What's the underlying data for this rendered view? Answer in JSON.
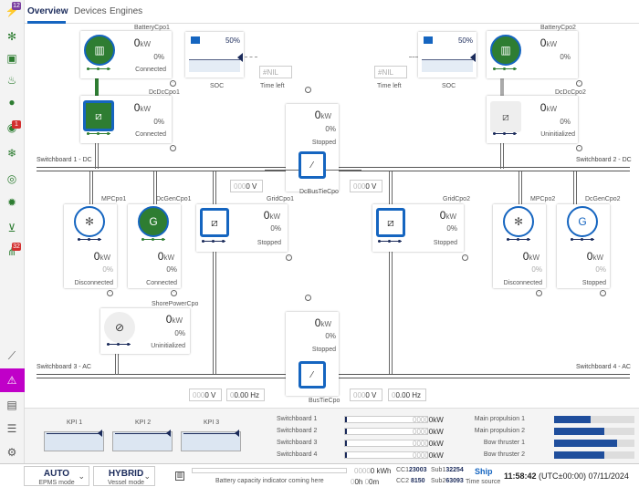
{
  "tabs": [
    {
      "label": "Overview",
      "active": true
    },
    {
      "label": "Devices",
      "active": false
    },
    {
      "label": "Engines",
      "active": false
    }
  ],
  "rail": {
    "icons": [
      "energy-icon",
      "fan-icon",
      "cabinet-icon",
      "flame-icon",
      "tank-icon",
      "sensor-icon",
      "snowflake-icon",
      "ring-icon",
      "bulb-icon",
      "valve-icon",
      "network-icon",
      "chart-icon",
      "alarm-icon",
      "document-icon",
      "list-icon",
      "gear-icon"
    ],
    "badges": {
      "top": "12",
      "mid": "1",
      "net": "32"
    }
  },
  "switchboards": {
    "sb1": "Switchboard 1 - DC",
    "sb2": "Switchboard 2 - DC",
    "sb3": "Switchboard 3 - AC",
    "sb4": "Switchboard 4 - AC"
  },
  "units": {
    "kw": "kW",
    "pct": "%",
    "v": "V",
    "hz": "Hz"
  },
  "cards": {
    "battery1": {
      "name": "BatteryCpo1",
      "kw": "0",
      "pct": "0",
      "status": "Connected"
    },
    "dcdc1": {
      "name": "DcDcCpo1",
      "kw": "0",
      "pct": "0",
      "status": "Connected"
    },
    "battery2": {
      "name": "BatteryCpo2",
      "kw": "0",
      "pct": "0",
      "status": ""
    },
    "dcdc2": {
      "name": "DcDcCpo2",
      "kw": "0",
      "pct": "0",
      "status": "Uninitialized"
    },
    "dcbustie": {
      "name": "DcBusTieCpo",
      "kw": "0",
      "pct": "0",
      "status": "Stopped"
    },
    "mp1": {
      "name": "MPCpo1",
      "kw": "0",
      "pct": "0",
      "status": "Disconnected"
    },
    "dcgen1": {
      "name": "DcGenCpo1",
      "kw": "0",
      "pct": "0",
      "status": "Connected"
    },
    "grid1": {
      "name": "GridCpo1",
      "kw": "0",
      "pct": "0",
      "status": "Stopped"
    },
    "grid2": {
      "name": "GridCpo2",
      "kw": "0",
      "pct": "0",
      "status": "Stopped"
    },
    "mp2": {
      "name": "MPCpo2",
      "kw": "0",
      "pct": "0",
      "status": "Disconnected"
    },
    "dcgen2": {
      "name": "DcGenCpo2",
      "kw": "0",
      "pct": "0",
      "status": "Stopped"
    },
    "shore": {
      "name": "ShorePowerCpo",
      "kw": "0",
      "pct": "0",
      "status": "Uninitialized"
    },
    "bustie": {
      "name": "BusTieCpo",
      "kw": "0",
      "pct": "0",
      "status": "Stopped"
    }
  },
  "soc": {
    "left": {
      "pct": "50%",
      "label": "SOC",
      "level": 0.5
    },
    "right": {
      "pct": "50%",
      "label": "SOC",
      "level": 0.5
    },
    "time_left_label": "Time left",
    "nil": "#NIL"
  },
  "fields": {
    "dc_v_left": {
      "dim": "000",
      "val": "0 V"
    },
    "dc_v_right": {
      "dim": "000",
      "val": "0 V"
    },
    "ac_v_left": {
      "dim": "000",
      "val": "0 V"
    },
    "ac_hz_left": {
      "dim": "0",
      "val": "0.00 Hz"
    },
    "ac_v_right": {
      "dim": "000",
      "val": "0 V"
    },
    "ac_hz_right": {
      "dim": "0",
      "val": "0.00 Hz"
    }
  },
  "kpis": [
    {
      "label": "KPI 1"
    },
    {
      "label": "KPI 2"
    },
    {
      "label": "KPI 3"
    }
  ],
  "switchboard_loads": [
    {
      "label": "Switchboard 1",
      "dim": "0000",
      "val": "0kW"
    },
    {
      "label": "Switchboard 2",
      "dim": "0000",
      "val": "0kW"
    },
    {
      "label": "Switchboard 3",
      "dim": "0000",
      "val": "0kW"
    },
    {
      "label": "Switchboard 4",
      "dim": "0000",
      "val": "0kW"
    }
  ],
  "thrusters": [
    {
      "label": "Main propulsion 1",
      "level": 0.45
    },
    {
      "label": "Main propulsion 2",
      "level": 0.62
    },
    {
      "label": "Bow thruster 1",
      "level": 0.78
    },
    {
      "label": "Bow thruster 2",
      "level": 0.62
    }
  ],
  "footer": {
    "epms_value": "AUTO",
    "epms_label": "EPMS mode",
    "vessel_value": "HYBRID",
    "vessel_label": "Vessel mode",
    "battery_msg": "Battery capacity indicator coming here",
    "kwh_dim": "0000",
    "kwh_val": "0 kWh",
    "h_val": "0h",
    "m_val": "0m",
    "h_dim": "0",
    "m_dim": "0",
    "cc1_label": "CC1",
    "cc1_val": "23003",
    "cc2_label": "CC2",
    "cc2_val": "8150",
    "sub1_label": "Sub1",
    "sub1_val": "32254",
    "sub2_label": "Sub2",
    "sub2_val": "63093",
    "time_source_value": "Ship",
    "time_source_label": "Time source",
    "clock": "11:58:42",
    "tz": "(UTC±00:00)",
    "date": "07/11/2024"
  },
  "colors": {
    "accent": "#1565c0",
    "ok": "#2e7d32",
    "active_rail": "#c000c8",
    "navy": "#1a2a5a"
  }
}
